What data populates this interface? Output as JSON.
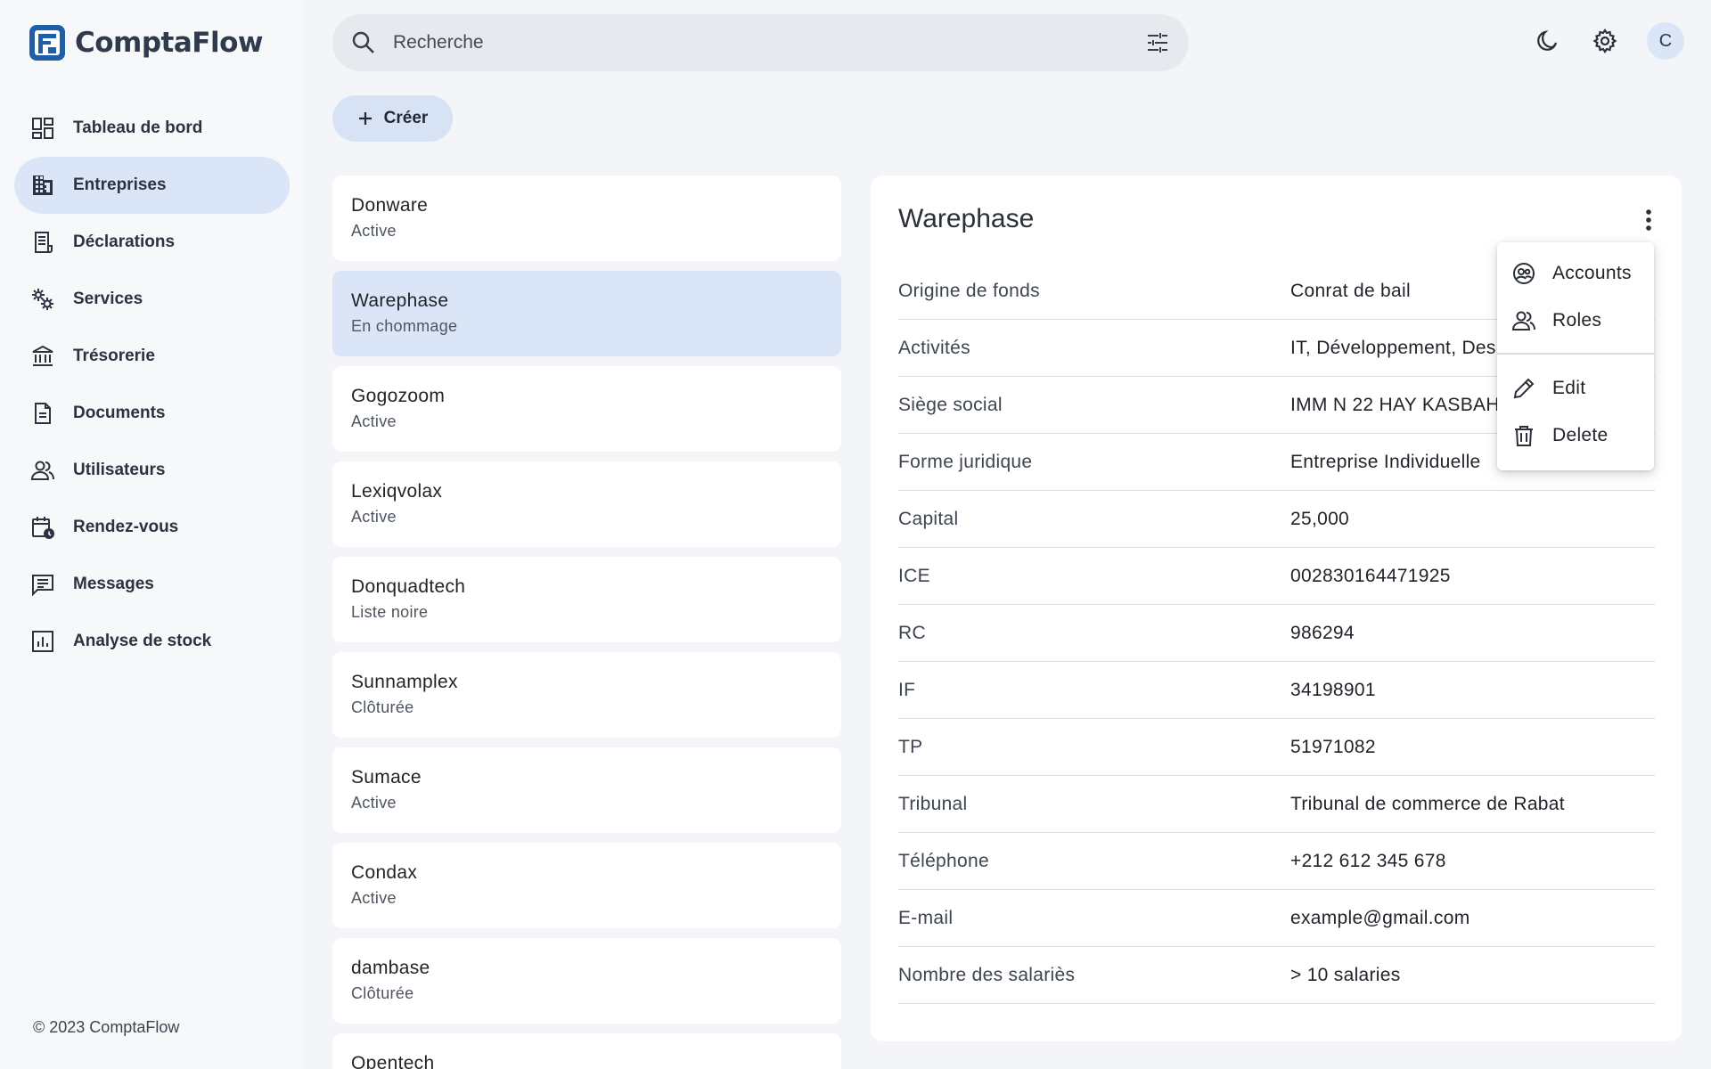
{
  "app": {
    "name": "ComptaFlow"
  },
  "sidebar": {
    "items": [
      {
        "label": "Tableau de bord",
        "icon": "dashboard-icon"
      },
      {
        "label": "Entreprises",
        "icon": "building-icon",
        "active": true
      },
      {
        "label": "Déclarations",
        "icon": "receipt-icon"
      },
      {
        "label": "Services",
        "icon": "gears-icon"
      },
      {
        "label": "Trésorerie",
        "icon": "bank-icon"
      },
      {
        "label": "Documents",
        "icon": "document-icon"
      },
      {
        "label": "Utilisateurs",
        "icon": "users-icon"
      },
      {
        "label": "Rendez-vous",
        "icon": "calendar-clock-icon"
      },
      {
        "label": "Messages",
        "icon": "message-icon"
      },
      {
        "label": "Analyse de stock",
        "icon": "chart-icon"
      }
    ],
    "footer": "© 2023 ComptaFlow"
  },
  "search": {
    "placeholder": "Recherche",
    "value": ""
  },
  "topbar": {
    "avatar_initial": "C"
  },
  "create_button": {
    "label": "Créer"
  },
  "companies": [
    {
      "name": "Donware",
      "status": "Active"
    },
    {
      "name": "Warephase",
      "status": "En chommage",
      "selected": true
    },
    {
      "name": "Gogozoom",
      "status": "Active"
    },
    {
      "name": "Lexiqvolax",
      "status": "Active"
    },
    {
      "name": "Donquadtech",
      "status": "Liste noire"
    },
    {
      "name": "Sunnamplex",
      "status": "Clôturée"
    },
    {
      "name": "Sumace",
      "status": "Active"
    },
    {
      "name": "Condax",
      "status": "Active"
    },
    {
      "name": "dambase",
      "status": "Clôturée"
    },
    {
      "name": "Opentech",
      "status": ""
    }
  ],
  "detail": {
    "title": "Warephase",
    "fields": [
      {
        "key": "Origine de fonds",
        "value": "Conrat de bail"
      },
      {
        "key": "Activités",
        "value": "IT, Développement, Des"
      },
      {
        "key": "Siège social",
        "value": "IMM N 22 HAY KASBAH"
      },
      {
        "key": "Forme juridique",
        "value": "Entreprise Individuelle"
      },
      {
        "key": "Capital",
        "value": "25,000"
      },
      {
        "key": "ICE",
        "value": "002830164471925"
      },
      {
        "key": "RC",
        "value": "986294"
      },
      {
        "key": "IF",
        "value": "34198901"
      },
      {
        "key": "TP",
        "value": "51971082"
      },
      {
        "key": "Tribunal",
        "value": "Tribunal de commerce de Rabat"
      },
      {
        "key": "Téléphone",
        "value": "+212 612 345 678"
      },
      {
        "key": "E-mail",
        "value": "example@gmail.com"
      },
      {
        "key": "Nombre des salariès",
        "value": "> 10 salaries"
      }
    ]
  },
  "context_menu": {
    "items": [
      {
        "label": "Accounts",
        "icon": "account-circle-icon"
      },
      {
        "label": "Roles",
        "icon": "roles-icon"
      },
      {
        "label": "Edit",
        "icon": "pencil-icon"
      },
      {
        "label": "Delete",
        "icon": "trash-icon"
      }
    ]
  },
  "colors": {
    "accent": "#dae6f7",
    "brand": "#2f3b4c",
    "logo_blue": "#1e5fa8",
    "background": "#f3f5f8"
  }
}
